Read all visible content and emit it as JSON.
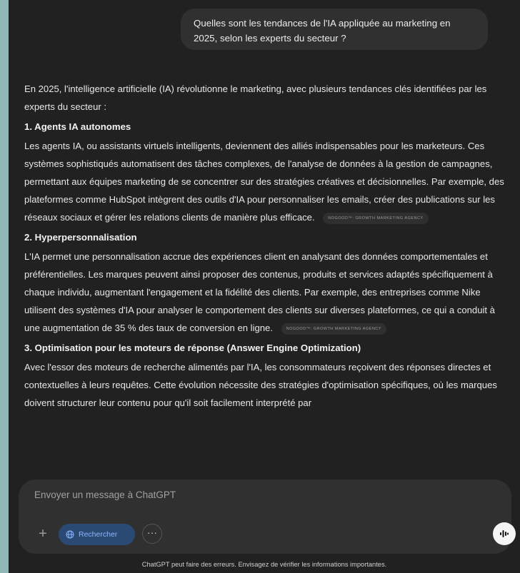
{
  "user_message": "Quelles sont les tendances de l'IA appliquée au marketing en 2025, selon les experts du secteur ?",
  "response": {
    "intro": "En 2025, l'intelligence artificielle (IA) révolutionne le marketing, avec plusieurs tendances clés identifiées par les experts du secteur :",
    "sections": [
      {
        "heading": "1. Agents IA autonomes",
        "body": "Les agents IA, ou assistants virtuels intelligents, deviennent des alliés indispensables pour les marketeurs. Ces systèmes sophistiqués automatisent des tâches complexes, de l'analyse de données à la gestion de campagnes, permettant aux équipes marketing de se concentrer sur des stratégies créatives et décisionnelles. Par exemple, des plateformes comme HubSpot intègrent des outils d'IA pour personnaliser les emails, créer des publications sur les réseaux sociaux et gérer les relations clients de manière plus efficace.",
        "source": "NOGOOD™: GROWTH MARKETING AGENCY"
      },
      {
        "heading": "2. Hyperpersonnalisation",
        "body": "L'IA permet une personnalisation accrue des expériences client en analysant des données comportementales et préférentielles. Les marques peuvent ainsi proposer des contenus, produits et services adaptés spécifiquement à chaque individu, augmentant l'engagement et la fidélité des clients. Par exemple, des entreprises comme Nike utilisent des systèmes d'IA pour analyser le comportement des clients sur diverses plateformes, ce qui a conduit à une augmentation de 35 % des taux de conversion en ligne.",
        "source": "NOGOOD™: GROWTH MARKETING AGENCY"
      },
      {
        "heading": "3. Optimisation pour les moteurs de réponse (Answer Engine Optimization)",
        "body": "Avec l'essor des moteurs de recherche alimentés par l'IA, les consommateurs reçoivent des réponses directes et contextuelles à leurs requêtes. Cette évolution nécessite des stratégies d'optimisation spécifiques, où les marques doivent structurer leur contenu pour qu'il soit facilement interprété par",
        "source": ""
      }
    ]
  },
  "composer": {
    "placeholder": "Envoyer un message à ChatGPT",
    "plus_label": "+",
    "search_label": "Rechercher",
    "more_label": "···",
    "search_icon": "globe-icon",
    "voice_icon": "voice-mode-icon"
  },
  "disclaimer": "ChatGPT peut faire des erreurs. Envisagez de vérifier les informations importantes.",
  "colors": {
    "background": "#212121",
    "bubble": "#303030",
    "accent": "#2a4a74",
    "accent_text": "#8ab4ff",
    "strip": "#8fb9b4"
  }
}
